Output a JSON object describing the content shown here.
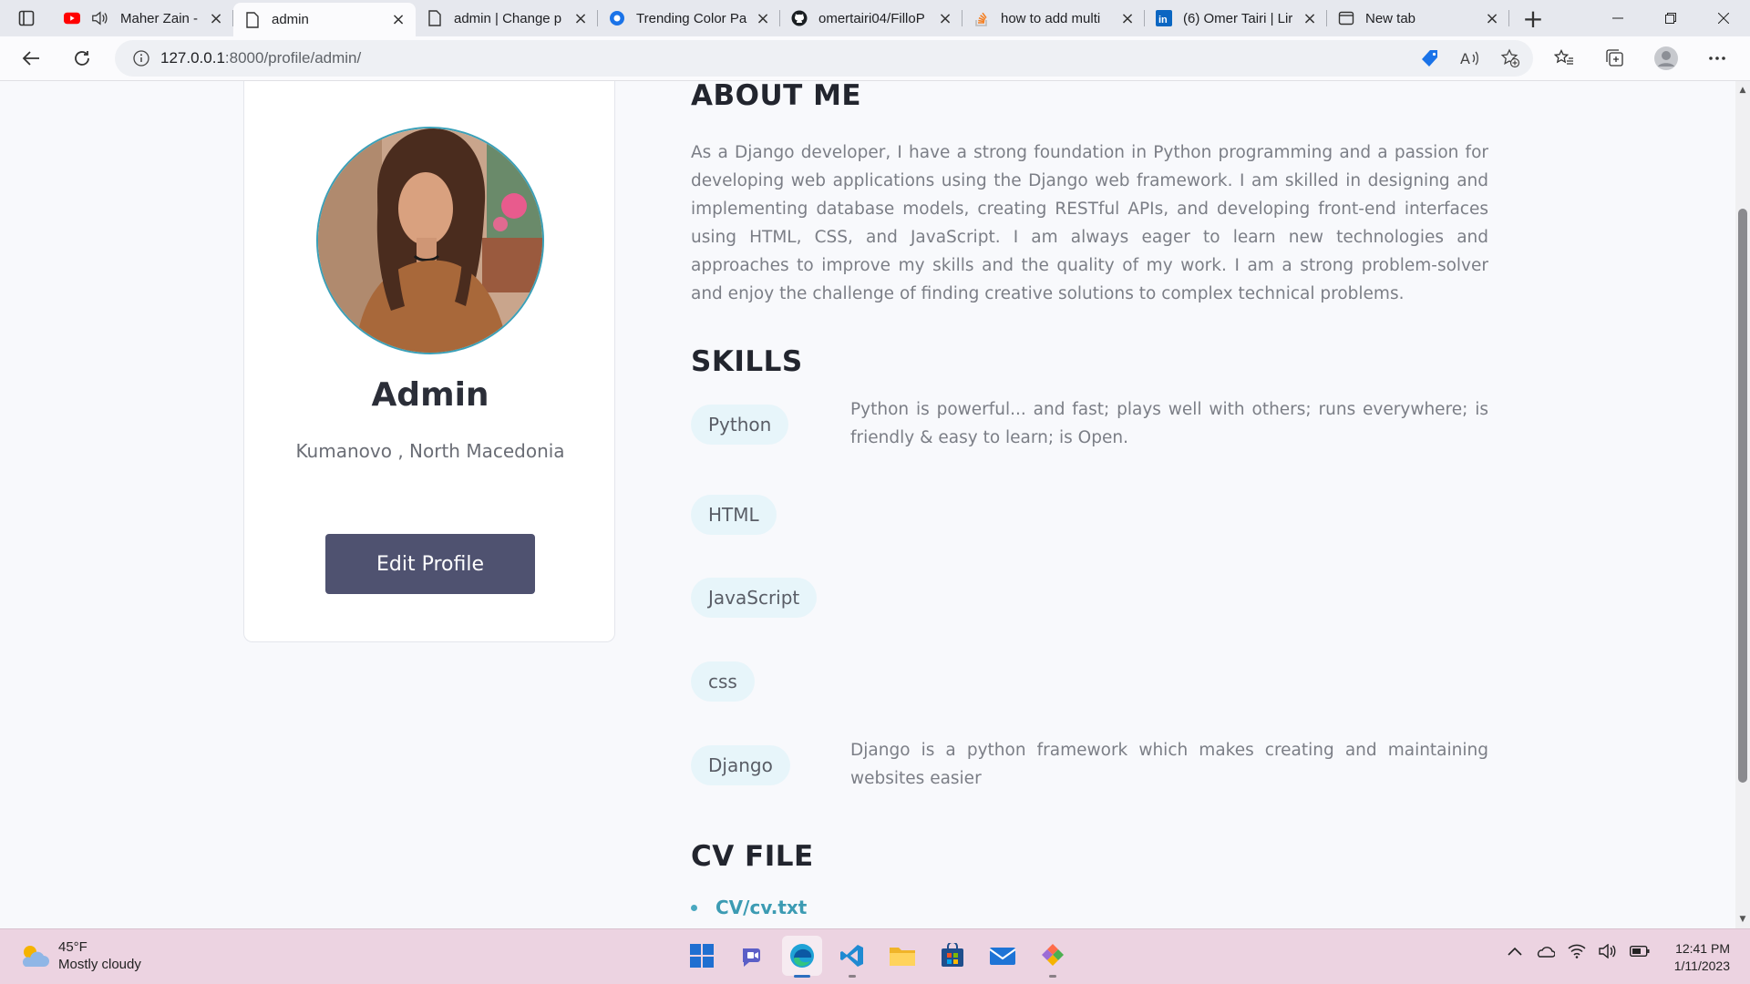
{
  "browser": {
    "tabs": [
      {
        "title": "Maher Zain -",
        "favicon": "youtube-icon",
        "audio": true
      },
      {
        "title": "admin",
        "favicon": "page-icon",
        "active": true
      },
      {
        "title": "admin | Change p",
        "favicon": "page-icon"
      },
      {
        "title": "Trending Color Pa",
        "favicon": "chrome-web-icon"
      },
      {
        "title": "omertairi04/FilloP",
        "favicon": "github-icon"
      },
      {
        "title": "how to add multi",
        "favicon": "stackoverflow-icon"
      },
      {
        "title": "(6) Omer Tairi | Lir",
        "favicon": "linkedin-icon"
      },
      {
        "title": "New tab",
        "favicon": "newtab-icon"
      }
    ],
    "url_host": "127.0.0.1",
    "url_path": ":8000/profile/admin/"
  },
  "profile": {
    "name": "Admin",
    "location": "Kumanovo , North Macedonia",
    "edit_label": "Edit Profile"
  },
  "about": {
    "title": "ABOUT ME",
    "text": "As a Django developer, I have a strong foundation in Python programming and a passion for developing web applications using the Django web framework. I am skilled in designing and implementing database models, creating RESTful APIs, and developing front-end interfaces using HTML, CSS, and JavaScript. I am always eager to learn new technologies and approaches to improve my skills and the quality of my work. I am a strong problem-solver and enjoy the challenge of finding creative solutions to complex technical problems."
  },
  "skills": {
    "title": "SKILLS",
    "items": [
      {
        "name": "Python",
        "description": "Python is powerful... and fast; plays well with others; runs everywhere; is friendly & easy to learn; is Open."
      },
      {
        "name": "HTML",
        "description": ""
      },
      {
        "name": "JavaScript",
        "description": ""
      },
      {
        "name": "css",
        "description": ""
      },
      {
        "name": "Django",
        "description": "Django is a python framework which makes creating and maintaining websites easier"
      }
    ]
  },
  "cv": {
    "title": "CV FILE",
    "files": [
      "CV/cv.txt"
    ]
  },
  "taskbar": {
    "temperature": "45°F",
    "weather": "Mostly cloudy",
    "time": "12:41 PM",
    "date": "1/11/2023"
  },
  "colors": {
    "accent": "#3aa0b8",
    "button": "#4f5270",
    "pill": "#e7f5fa"
  }
}
